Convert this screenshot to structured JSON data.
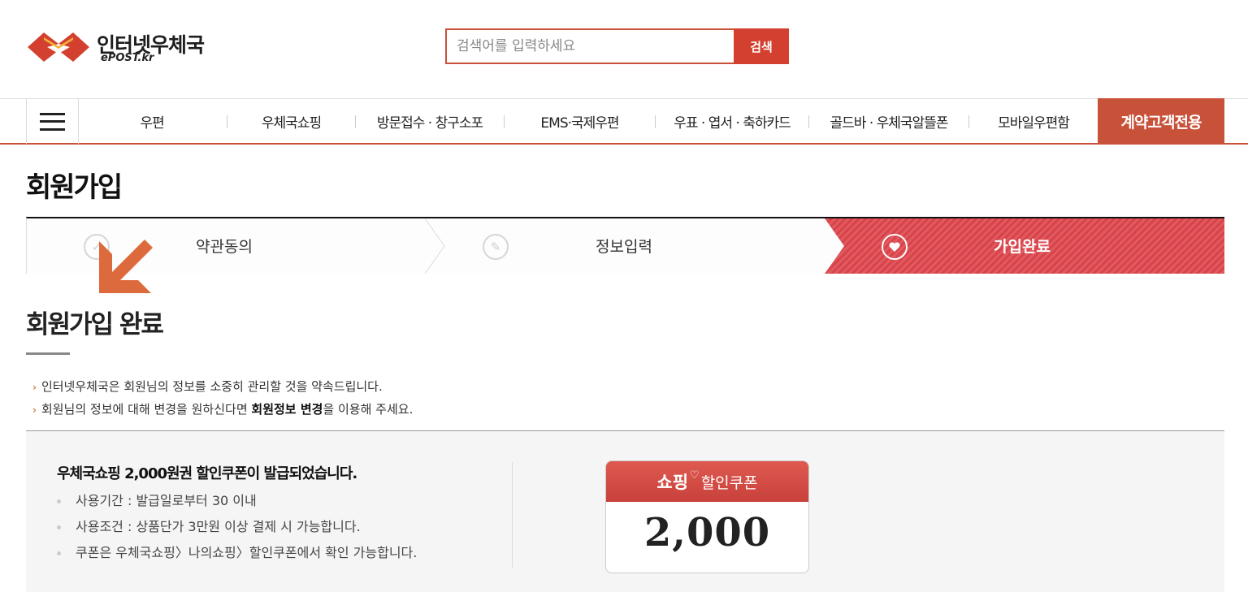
{
  "header": {
    "logo_title": "인터넷우체국",
    "logo_sub": "ePOST.kr",
    "search_placeholder": "검색어를 입력하세요",
    "search_button": "검색"
  },
  "nav": {
    "items": [
      "우편",
      "우체국쇼핑",
      "방문접수 · 창구소포",
      "EMS·국제우편",
      "우표 · 엽서 · 축하카드",
      "골드바 · 우체국알뜰폰",
      "모바일우편함"
    ],
    "special": "계약고객전용"
  },
  "page_title": "회원가입",
  "steps": [
    {
      "label": "약관동의"
    },
    {
      "label": "정보입력"
    },
    {
      "label": "가입완료",
      "active": true
    }
  ],
  "subtitle": "회원가입 완료",
  "notices": {
    "line1": "인터넷우체국은 회원님의 정보를 소중히 관리할 것을 약속드립니다.",
    "line2_pre": "회원님의 정보에 대해 변경을 원하신다면 ",
    "line2_bold": "회원정보 변경",
    "line2_post": "을 이용해 주세요."
  },
  "coupon": {
    "headline": "우체국쇼핑 2,000원권 할인쿠폰이 발급되었습니다.",
    "details": [
      "사용기간 : 발급일로부터 30 이내",
      "사용조건 : 상품단가 3만원 이상 결제 시 가능합니다.",
      "쿠폰은 우체국쇼핑〉나의쇼핑〉할인쿠폰에서 확인 가능합니다."
    ],
    "card_shop": "쇼핑",
    "card_label": "할인쿠폰",
    "card_amount": "2,000"
  },
  "colors": {
    "accent": "#c8513a",
    "step_active": "#d8434a",
    "search_button": "#d3402f"
  }
}
